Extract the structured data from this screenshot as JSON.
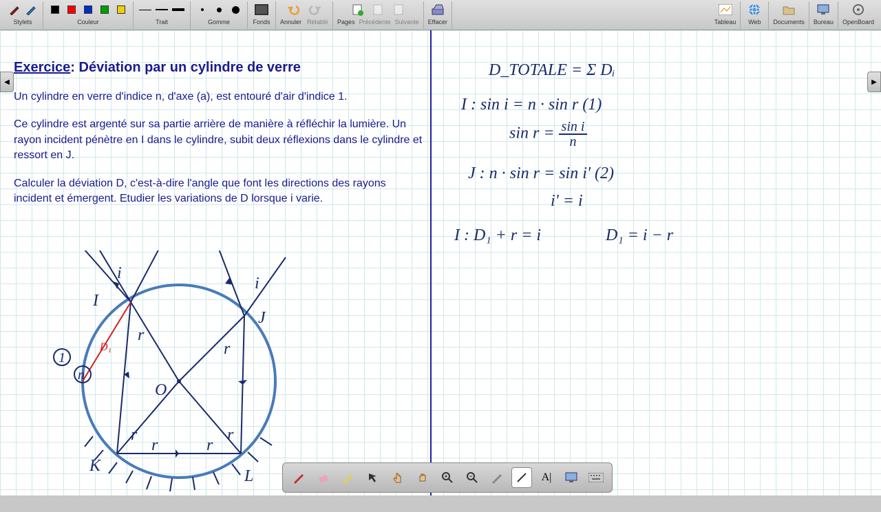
{
  "toolbar": {
    "stylets_label": "Stylets",
    "couleur_label": "Couleur",
    "trait_label": "Trait",
    "gomme_label": "Gomme",
    "fonds_label": "Fonds",
    "annuler_label": "Annuler",
    "retablir_label": "Rétablir",
    "pages_label": "Pages",
    "precedent_label": "Précédente",
    "suivante_label": "Suivante",
    "effacer_label": "Effacer",
    "tableau_label": "Tableau",
    "web_label": "Web",
    "documents_label": "Documents",
    "bureau_label": "Bureau",
    "openboard_label": "OpenBoard",
    "colors": [
      "#000000",
      "#ff0000",
      "#0030c0",
      "#00a000",
      "#f0d000"
    ]
  },
  "exercise": {
    "title_label": "Exercice",
    "title_rest": ":  Déviation par un cylindre de verre",
    "p1": "Un cylindre en verre d'indice n, d'axe (a), est entouré d'air d'indice 1.",
    "p2": "Ce cylindre est argenté sur sa partie arrière de manière à réfléchir la lumière. Un rayon incident pénètre en I dans le cylindre, subit deux réflexions dans le cylindre et ressort en J.",
    "p3": "Calculer la déviation D, c'est-à-dire l'angle que font les directions des rayons incident et émergent. Etudier les variations de D lorsque i varie."
  },
  "math": {
    "l1": "D_TOTALE  =  Σ Dᵢ",
    "l2a": "I :   sin i = n · sin r   (1)",
    "l2b": "sin r  =",
    "l2b_num": "sin i",
    "l2b_den": "n",
    "l3a": "J :   n · sin r  =  sin i'  (2)",
    "l3b": "i'  =  i",
    "l4a": "I :  D₁ + r  =  i",
    "l4b": "D₁  =  i − r"
  },
  "diagram_labels": {
    "I": "I",
    "J": "J",
    "K": "K",
    "L": "L",
    "O": "O",
    "i": "i",
    "r": "r",
    "one": "1",
    "n": "n",
    "D1": "D₁"
  },
  "bottom": {
    "text_label": "A|"
  }
}
